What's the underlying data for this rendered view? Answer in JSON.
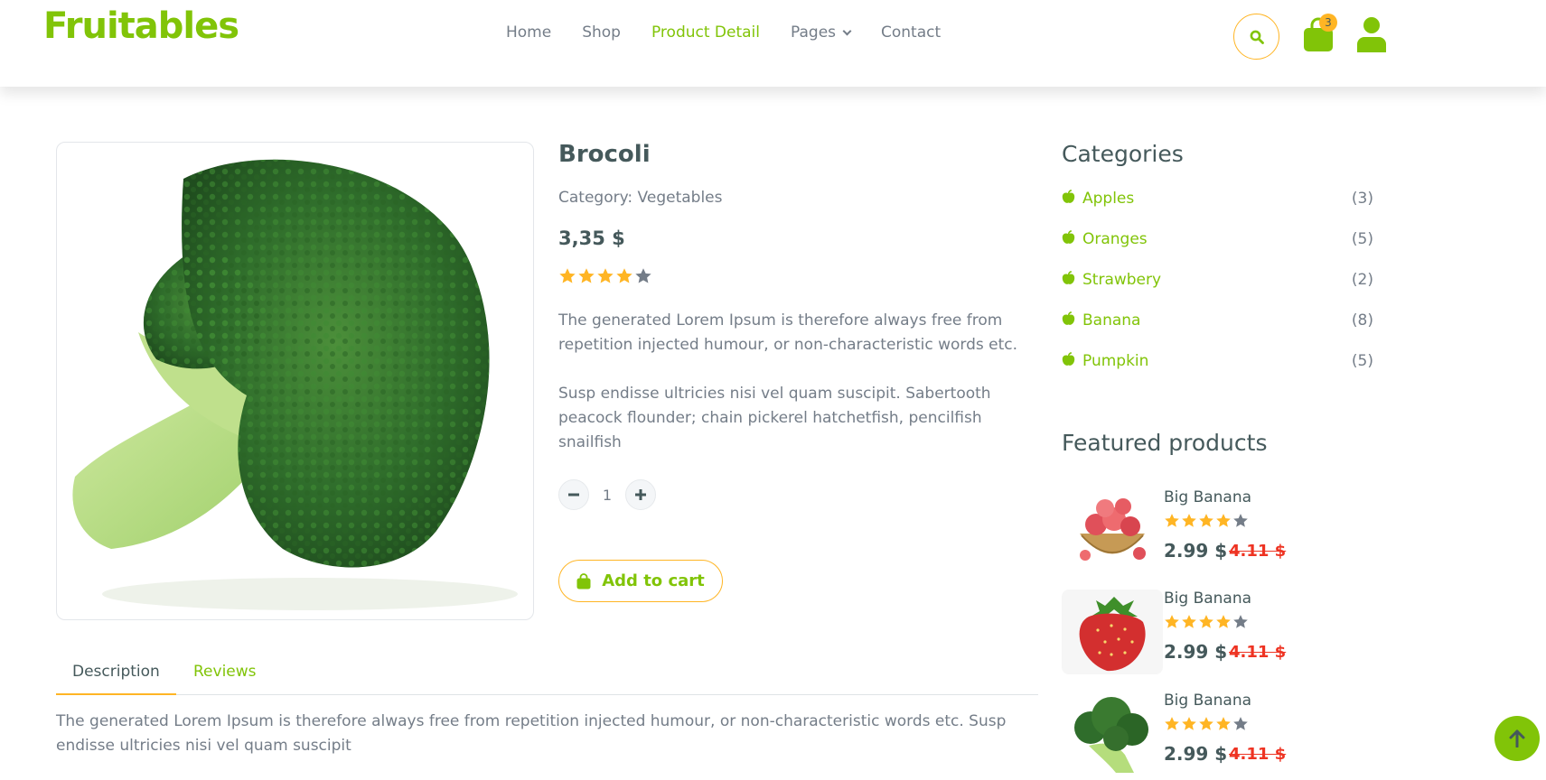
{
  "brand": "Fruitables",
  "nav": {
    "items": [
      {
        "label": "Home",
        "active": false
      },
      {
        "label": "Shop",
        "active": false
      },
      {
        "label": "Product Detail",
        "active": true
      },
      {
        "label": "Pages",
        "active": false,
        "dropdown": true
      },
      {
        "label": "Contact",
        "active": false
      }
    ],
    "cart_count": "3",
    "icons": [
      "search-icon",
      "shopping-bag-icon",
      "user-icon"
    ]
  },
  "product": {
    "title": "Brocoli",
    "category": "Category: Vegetables",
    "price": "3,35 $",
    "rating": 4,
    "rating_max": 5,
    "description_1": "The generated Lorem Ipsum is therefore always free from repetition injected humour, or non-characteristic words etc.",
    "description_2": "Susp endisse ultricies nisi vel quam suscipit. Sabertooth peacock flounder; chain pickerel hatchetfish, pencilfish snailfish",
    "quantity": "1",
    "add_to_cart_label": "Add to cart"
  },
  "tabs": {
    "items": [
      {
        "label": "Description",
        "active": true
      },
      {
        "label": "Reviews",
        "active": false
      }
    ],
    "body": "The generated Lorem Ipsum is therefore always free from repetition injected humour, or non-characteristic words etc. Susp endisse ultricies nisi vel quam suscipit"
  },
  "sidebar": {
    "categories_title": "Categories",
    "categories": [
      {
        "name": "Apples",
        "count": "(3)"
      },
      {
        "name": "Oranges",
        "count": "(5)"
      },
      {
        "name": "Strawbery",
        "count": "(2)"
      },
      {
        "name": "Banana",
        "count": "(8)"
      },
      {
        "name": "Pumpkin",
        "count": "(5)"
      }
    ],
    "featured_title": "Featured products",
    "featured": [
      {
        "name": "Big Banana",
        "rating": 4,
        "price": "2.99 $",
        "old_price": "4.11 $",
        "thumb": "apple-basket"
      },
      {
        "name": "Big Banana",
        "rating": 4,
        "price": "2.99 $",
        "old_price": "4.11 $",
        "thumb": "strawberry"
      },
      {
        "name": "Big Banana",
        "rating": 4,
        "price": "2.99 $",
        "old_price": "4.11 $",
        "thumb": "broccoli"
      }
    ]
  },
  "colors": {
    "primary": "#81c408",
    "secondary": "#ffb524",
    "dark": "#45595b",
    "muted": "#747d88",
    "star_empty": "#747d88",
    "old_price": "#ee3322"
  }
}
